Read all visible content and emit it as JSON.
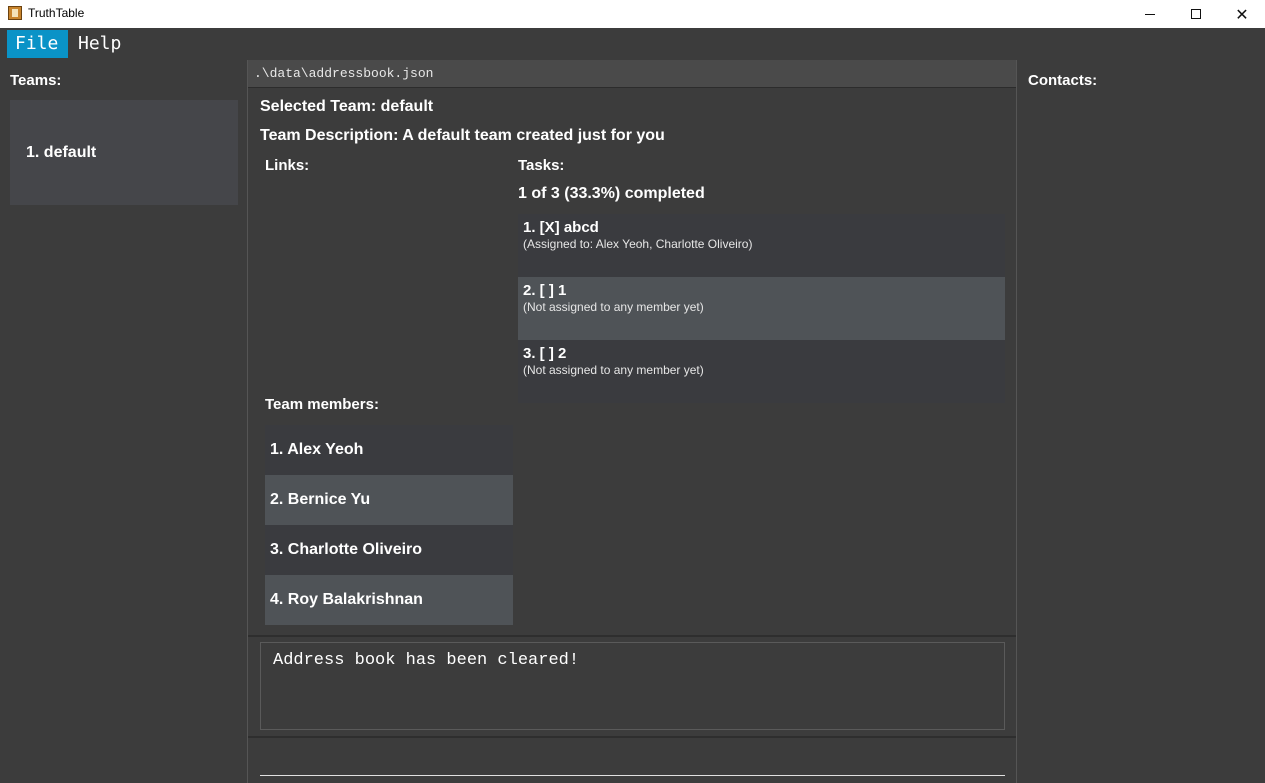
{
  "window": {
    "title": "TruthTable"
  },
  "menu": {
    "file": "File",
    "help": "Help"
  },
  "teams_panel": {
    "title": "Teams:",
    "items": [
      {
        "label": "1. default"
      }
    ]
  },
  "contacts_panel": {
    "title": "Contacts:"
  },
  "main": {
    "file_path": ".\\data\\addressbook.json",
    "selected_team": "Selected Team: default",
    "team_description": "Team Description: A default team created just for you",
    "links_title": "Links:",
    "tasks_title": "Tasks:",
    "tasks_progress": "1 of 3 (33.3%) completed",
    "tasks": [
      {
        "name": "1. [X] abcd",
        "assignment": "(Assigned to: Alex Yeoh, Charlotte Oliveiro)"
      },
      {
        "name": "2. [ ] 1",
        "assignment": "(Not assigned to any member yet)"
      },
      {
        "name": "3. [ ] 2",
        "assignment": "(Not assigned to any member yet)"
      }
    ],
    "members_title": "Team members:",
    "members": [
      {
        "label": "1. Alex Yeoh"
      },
      {
        "label": "2. Bernice Yu"
      },
      {
        "label": "3. Charlotte Oliveiro"
      },
      {
        "label": "4. Roy Balakrishnan"
      }
    ],
    "result_message": "Address book has been cleared!",
    "command_value": ""
  },
  "colors": {
    "accent": "#0a93c7",
    "background": "#3c3c3c",
    "list_item": "#3a3b3f",
    "list_item_alt": "#4f5357"
  },
  "icons": {
    "app": "app-icon",
    "minimize": "minimize-icon",
    "maximize": "maximize-icon",
    "close": "close-icon"
  }
}
